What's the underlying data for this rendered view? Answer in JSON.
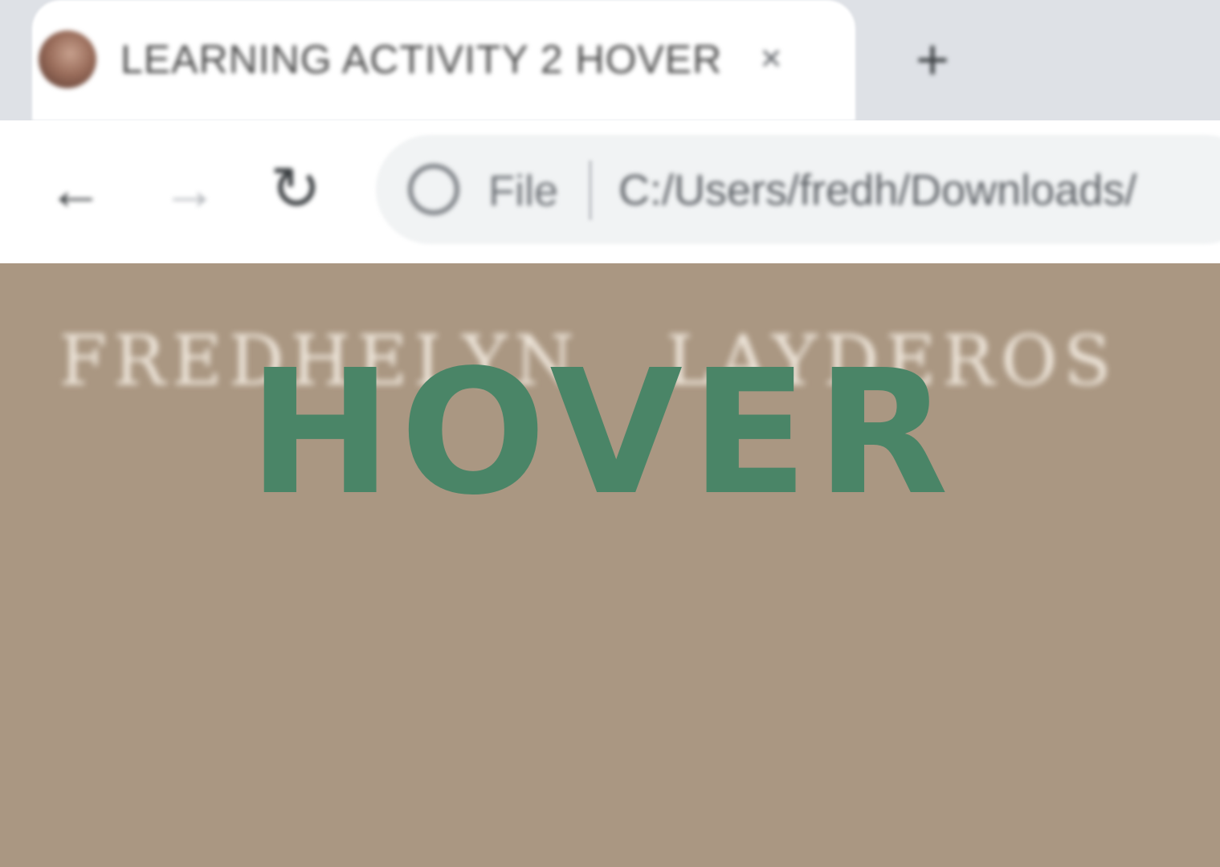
{
  "browser": {
    "tab": {
      "title": "LEARNING ACTIVITY 2 HOVER",
      "favicon": "profile-photo-icon",
      "close_glyph": "×"
    },
    "new_tab_glyph": "+",
    "toolbar": {
      "back_glyph": "←",
      "forward_glyph": "→",
      "reload_glyph": "↻"
    },
    "omnibox": {
      "icon": "globe-icon",
      "scheme_label": "File",
      "url": "C:/Users/fredh/Downloads/"
    }
  },
  "page": {
    "name": "FREDHELYN   LAYDEROS",
    "hover_label": "HOVER",
    "colors": {
      "background": "#aa9782",
      "hover_text": "#4a8567",
      "name_text": "#efe7dc"
    }
  }
}
